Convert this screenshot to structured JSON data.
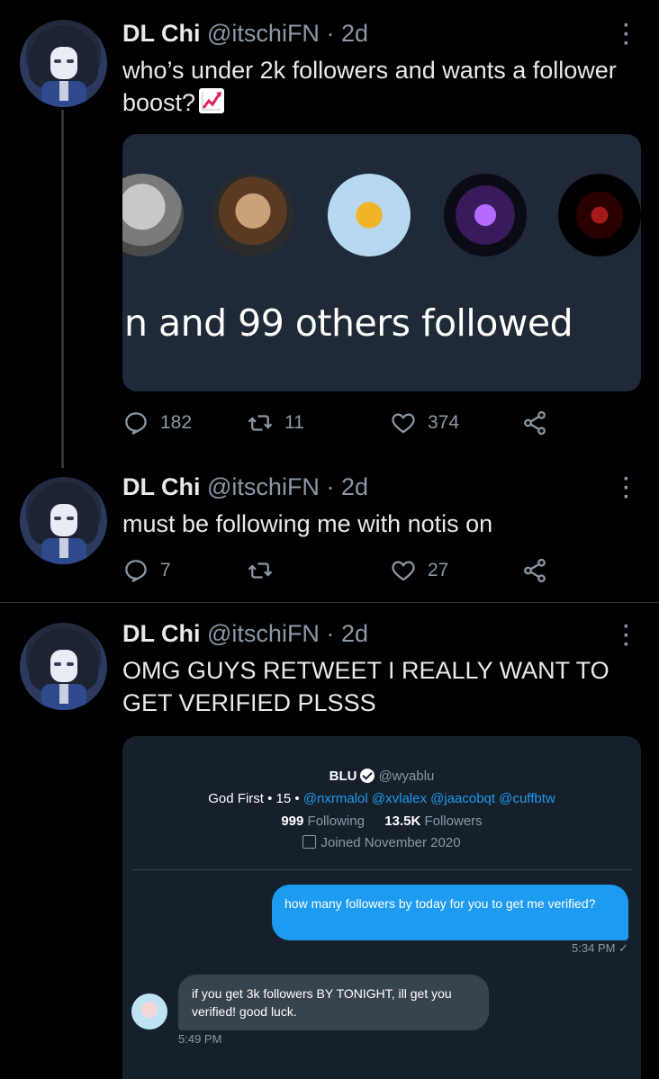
{
  "tweets": [
    {
      "name": "DL Chi",
      "handle": "@itschiFN",
      "time": "2d",
      "text": "who’s under 2k followers and wants a follower boost?",
      "emoji": "chart-increasing-emoji",
      "card": {
        "text": "n and 99 others followed"
      },
      "actions": {
        "replies": "182",
        "retweets": "11",
        "likes": "374"
      }
    },
    {
      "name": "DL Chi",
      "handle": "@itschiFN",
      "time": "2d",
      "text": "must be following me with notis on",
      "actions": {
        "replies": "7",
        "retweets": "",
        "likes": "27"
      }
    },
    {
      "name": "DL Chi",
      "handle": "@itschiFN",
      "time": "2d",
      "text": "OMG GUYS RETWEET I REALLY WANT TO GET VERIFIED PLSSS",
      "card": {
        "profile_name": "BLU",
        "profile_handle": "@wyablu",
        "bio_prefix": "God First • 15 •",
        "bio_mentions": "@nxrmalol @xvlalex @jaacobqt @cuffbtw",
        "following_count": "999",
        "following_label": "Following",
        "followers_count": "13.5K",
        "followers_label": "Followers",
        "joined": "Joined November 2020",
        "dm_out": "how many followers by today for you to get me verified?",
        "dm_out_time": "5:34 PM",
        "dm_in": "if you get 3k followers BY TONIGHT, ill get you verified! good luck.",
        "dm_in_time": "5:49 PM"
      }
    }
  ]
}
